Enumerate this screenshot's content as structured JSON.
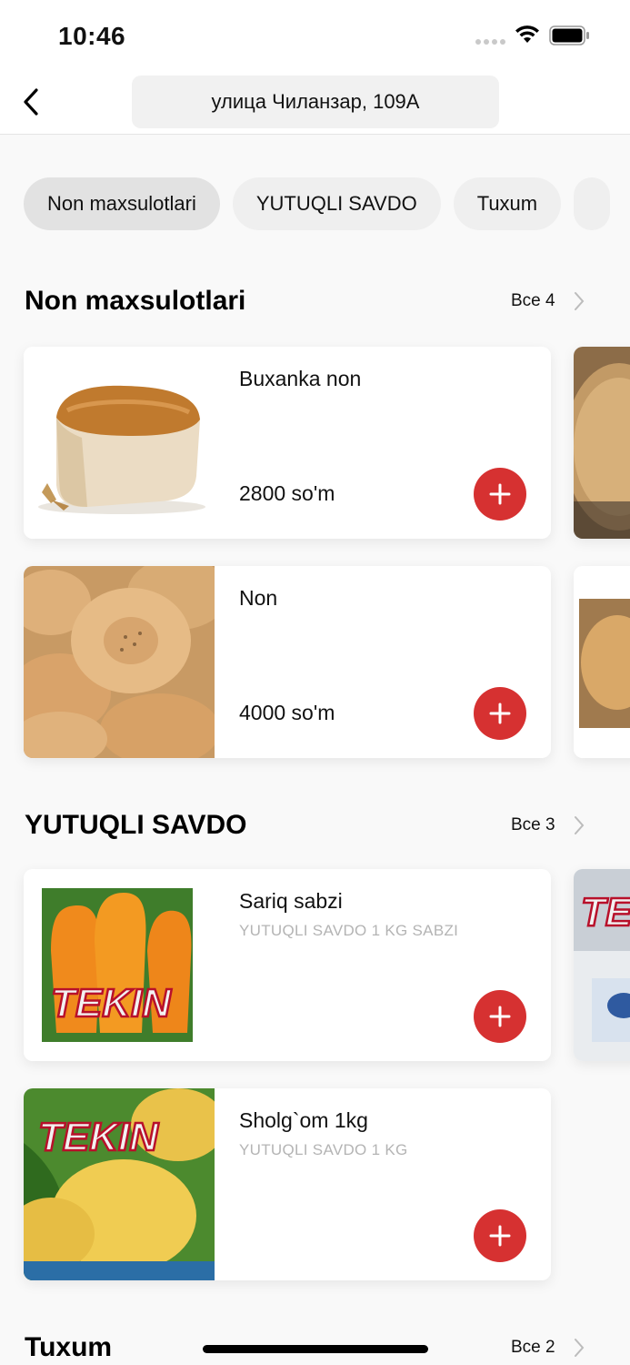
{
  "status": {
    "time": "10:46"
  },
  "header": {
    "address": "улица Чиланзар, 109А"
  },
  "chips": [
    "Non maxsulotlari",
    "YUTUQLI SAVDO",
    "Tuxum"
  ],
  "sections": [
    {
      "title": "Non maxsulotlari",
      "all_label": "Все 4"
    },
    {
      "title": "YUTUQLI SAVDO",
      "all_label": "Все 3"
    },
    {
      "title": "Tuxum",
      "all_label": "Все 2"
    }
  ],
  "products": [
    {
      "name": "Buxanka non",
      "price": "2800 so'm"
    },
    {
      "name": "Non",
      "price": "4000 so'm"
    },
    {
      "name": "Sariq sabzi",
      "description": "YUTUQLI SAVDO 1 KG SABZI"
    },
    {
      "name": "Sholg`om 1kg",
      "description": "YUTUQLI SAVDO 1 KG"
    }
  ],
  "brand_logo_text": "TEKIN",
  "colors": {
    "accent": "#d63131",
    "background": "#f9f9f9",
    "muted_text": "#b4b4b4"
  }
}
